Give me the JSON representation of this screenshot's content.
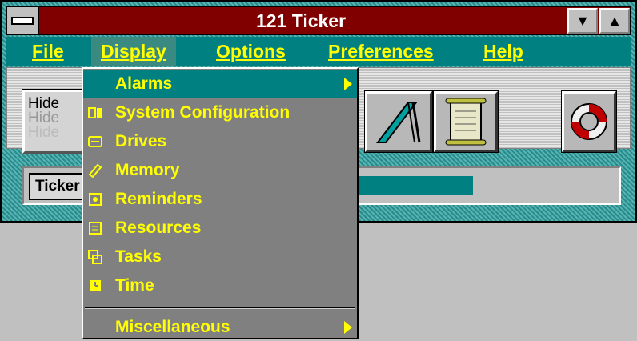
{
  "window": {
    "title": "121 Ticker"
  },
  "menubar": {
    "file": "File",
    "display": "Display",
    "options": "Options",
    "preferences": "Preferences",
    "help": "Help"
  },
  "toolbar": {
    "hide_button": {
      "line1": "Hide",
      "line2": "Hide",
      "line3": "Hide"
    }
  },
  "status": {
    "ticker_label": "Ticker"
  },
  "display_menu": {
    "items": [
      {
        "label": "Alarms",
        "icon": "none",
        "submenu": true,
        "highlighted": true
      },
      {
        "label": "System Configuration",
        "icon": "system-config-icon"
      },
      {
        "label": "Drives",
        "icon": "drive-icon"
      },
      {
        "label": "Memory",
        "icon": "memory-icon"
      },
      {
        "label": "Reminders",
        "icon": "reminder-icon"
      },
      {
        "label": "Resources",
        "icon": "resources-icon"
      },
      {
        "label": "Tasks",
        "icon": "tasks-icon"
      },
      {
        "label": "Time",
        "icon": "time-icon"
      }
    ],
    "misc": {
      "label": "Miscellaneous",
      "submenu": true
    }
  },
  "colors": {
    "titlebar": "#800000",
    "menubar": "#008080",
    "menu_text": "#ffff00",
    "menu_bg": "#808080"
  }
}
